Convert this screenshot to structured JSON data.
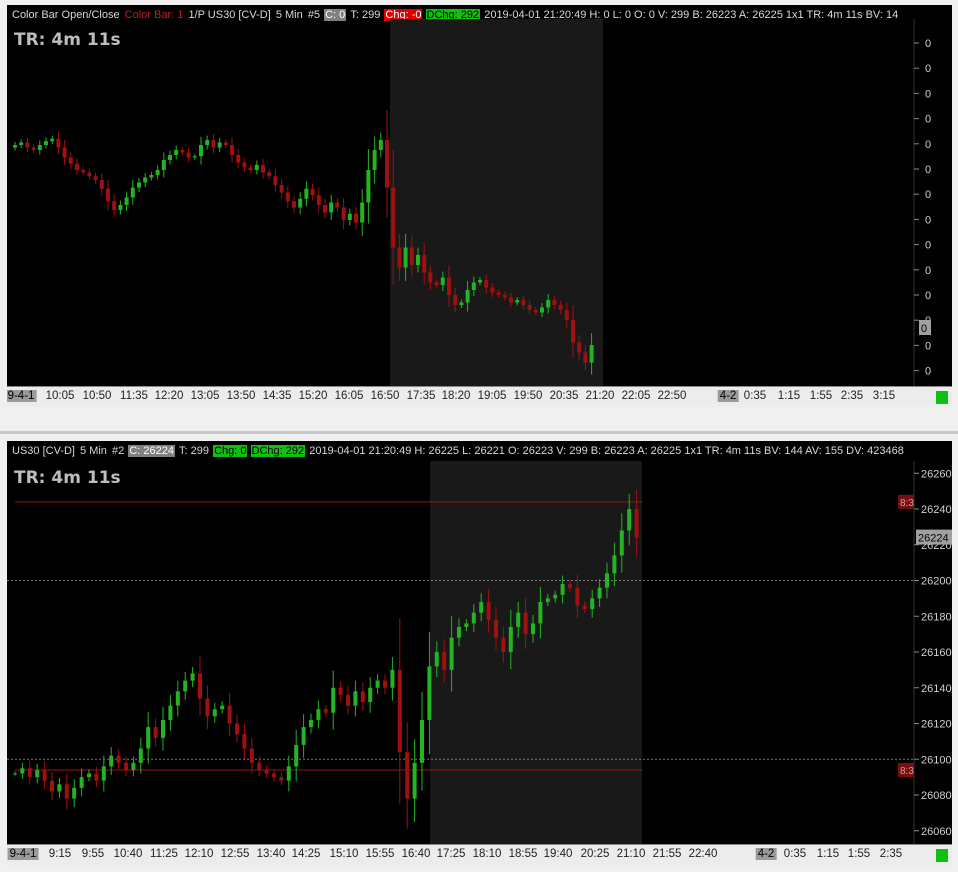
{
  "panel1": {
    "info": {
      "study": "Color Bar Open/Close",
      "colorbar": "Color Bar: 1",
      "symbol_prefix": "1/P US30 [CV-D]",
      "interval": "5 Min",
      "chart_no": "#5",
      "close": "C: 0",
      "ticks": "T: 299",
      "chg": "Chg: -0",
      "dchg": "DChg: 292",
      "rest": "2019-04-01 21:20:49 H: 0 L: 0 O: 0 V: 299 B: 26223 A: 26225 1x1 TR: 4m 11s BV: 14"
    },
    "tr_label": "TR: 4m 11s",
    "price_labels": [
      "0",
      "0",
      "0",
      "0",
      "0",
      "0",
      "0",
      "0",
      "0",
      "0",
      "0",
      "0",
      "0",
      "0"
    ],
    "current_value": "0",
    "time_labels": [
      "9-4-1",
      "10:05",
      "10:50",
      "11:35",
      "12:20",
      "13:05",
      "13:50",
      "14:35",
      "15:20",
      "16:05",
      "16:50",
      "17:35",
      "18:20",
      "19:05",
      "19:50",
      "20:35",
      "21:20",
      "22:05",
      "22:50",
      "4-2",
      "0:35",
      "1:15",
      "1:55",
      "2:35",
      "3:15"
    ]
  },
  "panel2": {
    "info": {
      "symbol": "US30 [CV-D]",
      "interval": "5 Min",
      "chart_no": "#2",
      "close": "C: 26224",
      "ticks": "T: 299",
      "chg": "Chg: 0",
      "dchg": "DChg: 292",
      "rest": "2019-04-01 21:20:49 H: 26225 L: 26221 O: 26223 V: 299 B: 26223 A: 26225 1x1 TR: 4m 11s BV: 144 AV: 155 DV: 423468"
    },
    "tr_label": "TR: 4m 11s",
    "price_labels": [
      "26260",
      "26240",
      "26220",
      "26200",
      "26180",
      "26160",
      "26140",
      "26120",
      "26100",
      "26080",
      "26060"
    ],
    "current_value": "26224",
    "line_tags": [
      "8:3",
      "8:3"
    ],
    "time_labels": [
      "9-4-1",
      "9:15",
      "9:55",
      "10:40",
      "11:25",
      "12:10",
      "12:55",
      "13:40",
      "14:25",
      "15:10",
      "15:55",
      "16:40",
      "17:25",
      "18:10",
      "18:55",
      "19:40",
      "20:25",
      "21:10",
      "21:55",
      "22:40",
      "4-2",
      "0:35",
      "1:15",
      "1:55",
      "2:35"
    ]
  },
  "chart_data": [
    {
      "type": "candlestick",
      "title": "1/P US30 [CV-D] 5 Min",
      "x_start": "2019-04-01 09:15",
      "x_step_minutes": 5,
      "close": [
        40,
        42,
        38,
        36,
        40,
        43,
        45,
        38,
        30,
        25,
        20,
        18,
        15,
        12,
        5,
        -5,
        -12,
        -8,
        -2,
        6,
        10,
        14,
        16,
        20,
        28,
        32,
        36,
        34,
        30,
        31,
        40,
        44,
        38,
        42,
        40,
        32,
        26,
        22,
        20,
        24,
        18,
        15,
        8,
        2,
        -5,
        -10,
        -3,
        5,
        0,
        -8,
        -14,
        -6,
        -10,
        -20,
        -15,
        -22,
        -6,
        20,
        36,
        44,
        6,
        -42,
        -58,
        -42,
        -56,
        -48,
        -62,
        -70,
        -72,
        -66,
        -80,
        -88,
        -86,
        -76,
        -70,
        -68,
        -74,
        -78,
        -80,
        -82,
        -86,
        -84,
        -88,
        -92,
        -94,
        -90,
        -84,
        -88,
        -92,
        -100,
        -118,
        -126,
        -134,
        -120
      ],
      "y_labels_printed": "0"
    },
    {
      "type": "candlestick",
      "title": "US30 [CV-D] 5 Min",
      "x_start": "2019-04-01 09:15",
      "x_step_minutes": 5,
      "close": [
        26092,
        26095,
        26090,
        26094,
        26088,
        26082,
        26086,
        26078,
        26084,
        26090,
        26092,
        26088,
        26096,
        26102,
        26098,
        26094,
        26098,
        26106,
        26118,
        26112,
        26122,
        26130,
        26138,
        26144,
        26148,
        26134,
        26124,
        26128,
        26130,
        26120,
        26114,
        26106,
        26098,
        26094,
        26092,
        26090,
        26088,
        26096,
        26108,
        26118,
        26122,
        26128,
        26126,
        26140,
        26136,
        26130,
        26138,
        26132,
        26140,
        26144,
        26140,
        26150,
        26104,
        26078,
        26098,
        26122,
        26152,
        26160,
        26150,
        26168,
        26174,
        26176,
        26182,
        26188,
        26178,
        26168,
        26160,
        26174,
        26182,
        26170,
        26176,
        26188,
        26190,
        26192,
        26198,
        26196,
        26186,
        26184,
        26190,
        26196,
        26204,
        26214,
        26228,
        26240,
        26224
      ],
      "ylim": [
        26050,
        26270
      ],
      "horizontal_lines": [
        26244,
        26094
      ],
      "dashed_gridlines": [
        26200,
        26100
      ]
    }
  ]
}
